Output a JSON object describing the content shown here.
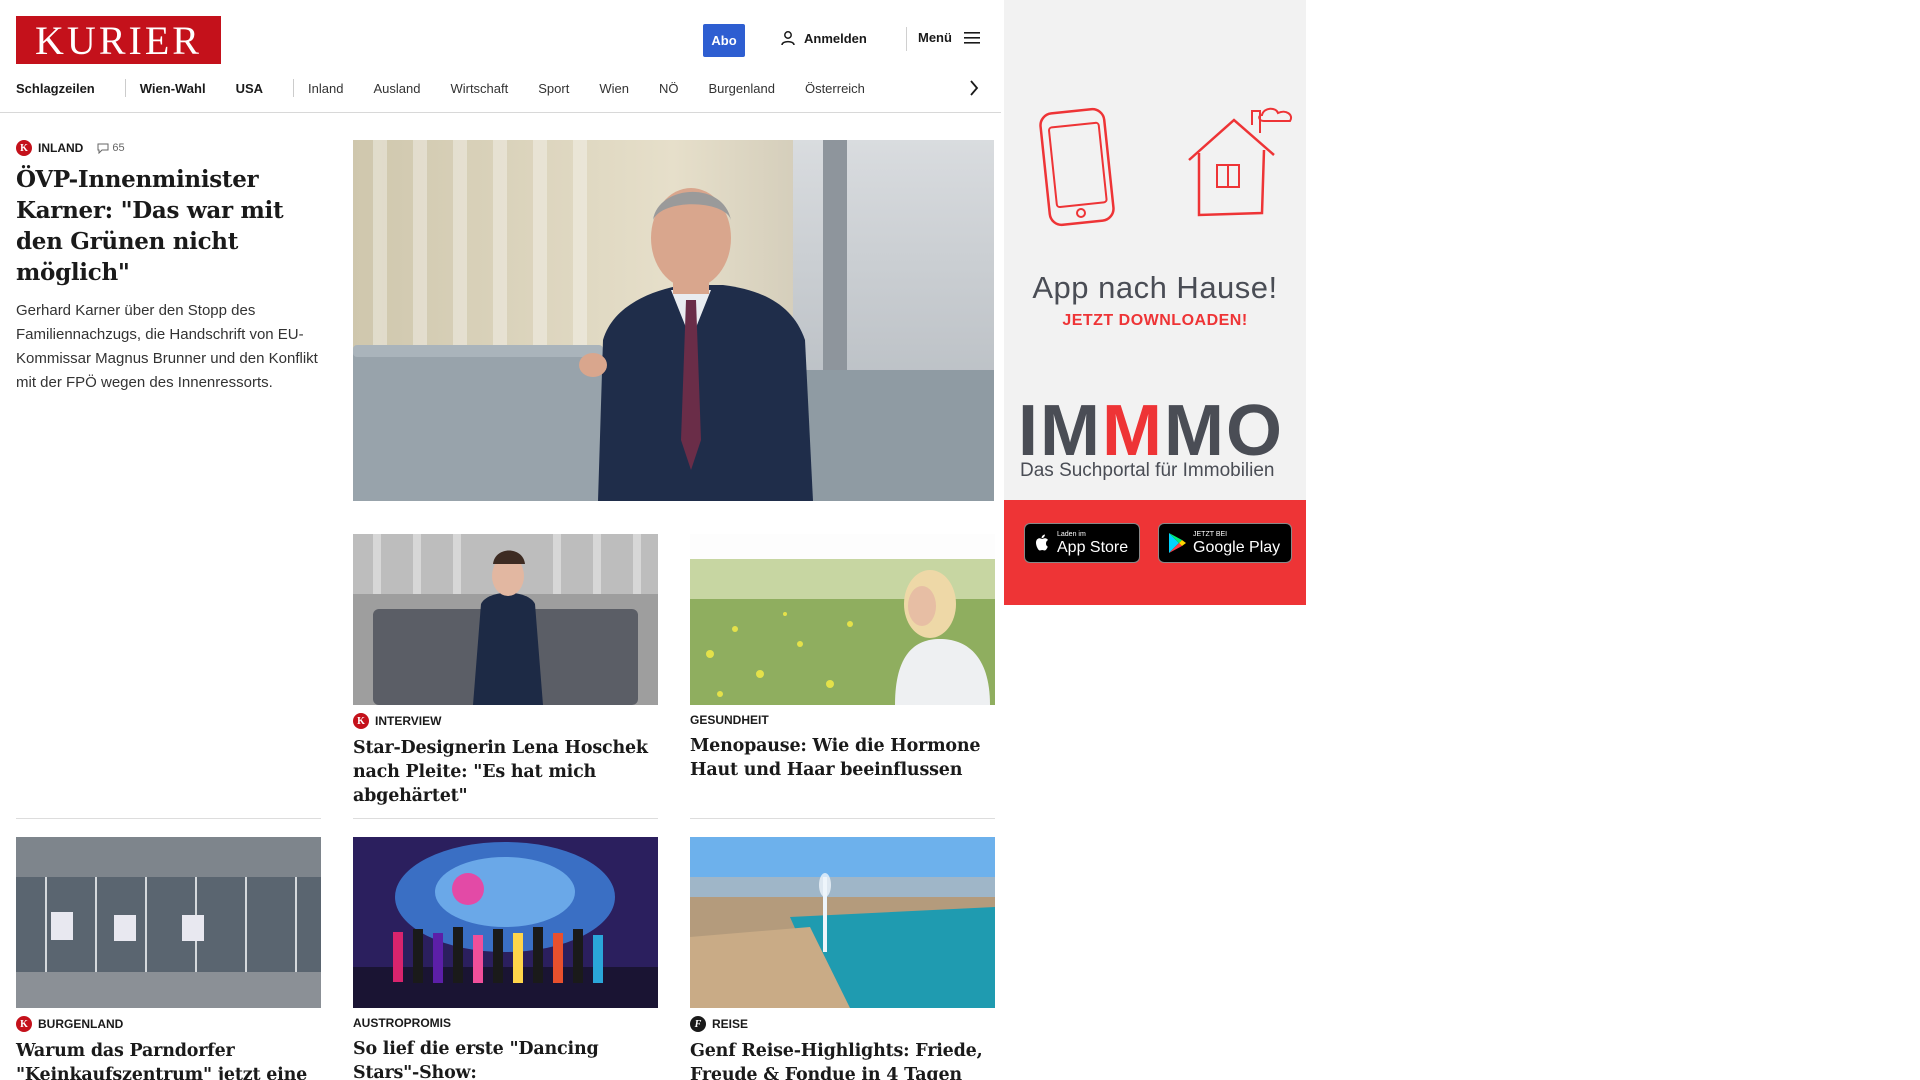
{
  "header": {
    "logo": "KURIER",
    "abo": "Abo",
    "login": "Anmelden",
    "menu": "Menü"
  },
  "nav": {
    "items": [
      "Schlagzeilen",
      "Wien-Wahl",
      "USA",
      "Inland",
      "Ausland",
      "Wirtschaft",
      "Sport",
      "Wien",
      "NÖ",
      "Burgenland",
      "Österreich"
    ]
  },
  "lead": {
    "kicker": "Inland",
    "comments": "65",
    "title": "ÖVP-Innenminister Karner: \"Das war mit den Grünen nicht möglich\"",
    "teaser": "Gerhard Karner über den Stopp des Familiennachzugs, die Handschrift von EU-Kommissar Magnus Brunner und den Konflikt mit der FPÖ wegen des Innenressorts."
  },
  "cards": [
    {
      "kicker": "Interview",
      "title": "Star-Designerin Lena Hoschek nach Pleite: \"Es hat mich abgehärtet\""
    },
    {
      "kicker": "Gesundheit",
      "title": "Menopause: Wie die Hormone Haut und Haar beeinflussen"
    },
    {
      "kicker": "Burgenland",
      "title": "Warum das Parndorfer \"Keinkaufszentrum\" jetzt eine zweite Chance bekommt"
    },
    {
      "kicker": "Austropromis",
      "title": "So lief die erste \"Dancing Stars\"-Show: Gesichtsakrobatik, Aussetzer und Kernöl-Adonis"
    },
    {
      "kicker": "Reise",
      "title": "Genf Reise-Highlights: Friede, Freude & Fondue in 4 Tagen"
    }
  ],
  "ad": {
    "headline": "App nach Hause!",
    "sub": "JETZT DOWNLOADEN!",
    "brand_a": "IM",
    "brand_m": "M",
    "brand_b": "MO",
    "tagline": "Das Suchportal für Immobilien",
    "appstore_small": "Laden im",
    "appstore_big": "App Store",
    "googleplay_small": "JETZT BEI",
    "googleplay_big": "Google Play"
  },
  "colors": {
    "brand_red": "#c4111b",
    "abo_blue": "#2e5ed1",
    "ad_red": "#ee3436"
  }
}
